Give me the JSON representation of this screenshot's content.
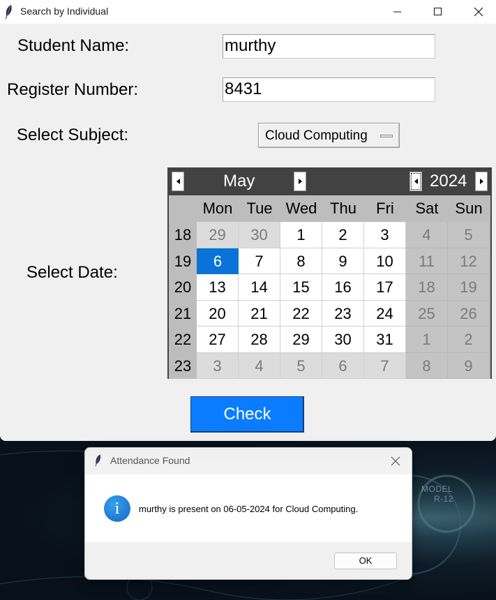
{
  "window": {
    "title": "Search by Individual"
  },
  "form": {
    "student_name_label": "Student Name:",
    "student_name_value": "murthy",
    "register_label": "Register Number:",
    "register_value": "8431",
    "subject_label": "Select Subject:",
    "subject_value": "Cloud Computing",
    "date_label": "Select Date:",
    "check_label": "Check"
  },
  "calendar": {
    "month": "May",
    "year": "2024",
    "weekdays": [
      "Mon",
      "Tue",
      "Wed",
      "Thu",
      "Fri",
      "Sat",
      "Sun"
    ],
    "selected_day": "6",
    "weeks": [
      {
        "wk": "18",
        "days": [
          "29",
          "30",
          "1",
          "2",
          "3",
          "4",
          "5"
        ],
        "kinds": [
          "oth",
          "oth",
          "cur",
          "cur",
          "cur",
          "we",
          "we"
        ]
      },
      {
        "wk": "19",
        "days": [
          "6",
          "7",
          "8",
          "9",
          "10",
          "11",
          "12"
        ],
        "kinds": [
          "sel",
          "cur",
          "cur",
          "cur",
          "cur",
          "we",
          "we"
        ]
      },
      {
        "wk": "20",
        "days": [
          "13",
          "14",
          "15",
          "16",
          "17",
          "18",
          "19"
        ],
        "kinds": [
          "cur",
          "cur",
          "cur",
          "cur",
          "cur",
          "we",
          "we"
        ]
      },
      {
        "wk": "21",
        "days": [
          "20",
          "21",
          "22",
          "23",
          "24",
          "25",
          "26"
        ],
        "kinds": [
          "cur",
          "cur",
          "cur",
          "cur",
          "cur",
          "we",
          "we"
        ]
      },
      {
        "wk": "22",
        "days": [
          "27",
          "28",
          "29",
          "30",
          "31",
          "1",
          "2"
        ],
        "kinds": [
          "cur",
          "cur",
          "cur",
          "cur",
          "cur",
          "we",
          "we"
        ]
      },
      {
        "wk": "23",
        "days": [
          "3",
          "4",
          "5",
          "6",
          "7",
          "8",
          "9"
        ],
        "kinds": [
          "oth",
          "oth",
          "oth",
          "oth",
          "oth",
          "we",
          "we"
        ]
      }
    ]
  },
  "dialog": {
    "title": "Attendance Found",
    "message": "murthy is present on 06-05-2024 for Cloud Computing.",
    "ok_label": "OK",
    "icon": "info-icon"
  },
  "background": {
    "label_line1": "MODEL",
    "label_line2": "R-12"
  },
  "colors": {
    "accent": "#0a7cff",
    "selected_day": "#0a72d8",
    "calendar_header": "#424242"
  }
}
